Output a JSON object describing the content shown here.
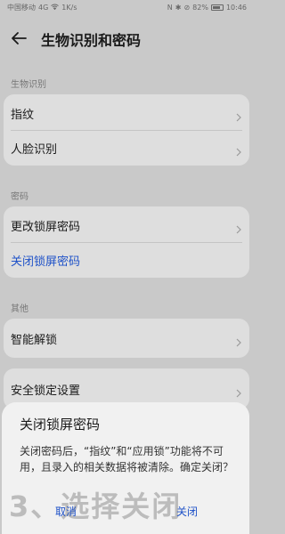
{
  "status_bar": {
    "carrier": "中国移动",
    "network": "4G",
    "speed": "1K/s",
    "battery": "82%",
    "time": "10:46"
  },
  "header": {
    "title": "生物识别和密码"
  },
  "sections": {
    "biometrics": {
      "label": "生物识别",
      "items": [
        {
          "label": "指纹"
        },
        {
          "label": "人脸识别"
        }
      ]
    },
    "password": {
      "label": "密码",
      "items": [
        {
          "label": "更改锁屏密码"
        },
        {
          "label": "关闭锁屏密码"
        }
      ]
    },
    "other": {
      "label": "其他",
      "items": [
        {
          "label": "智能解锁"
        },
        {
          "label": "安全锁定设置"
        }
      ]
    }
  },
  "dialog": {
    "title": "关闭锁屏密码",
    "message": "关闭密码后，“指纹”和“应用锁”功能将不可用，且录入的相关数据将被清除。确定关闭？",
    "cancel_label": "取消",
    "confirm_label": "关闭"
  },
  "overlay_caption": "3、选择关闭",
  "colors": {
    "accent": "#1f52c8",
    "card": "#dedede",
    "background": "#c9c9c9"
  }
}
